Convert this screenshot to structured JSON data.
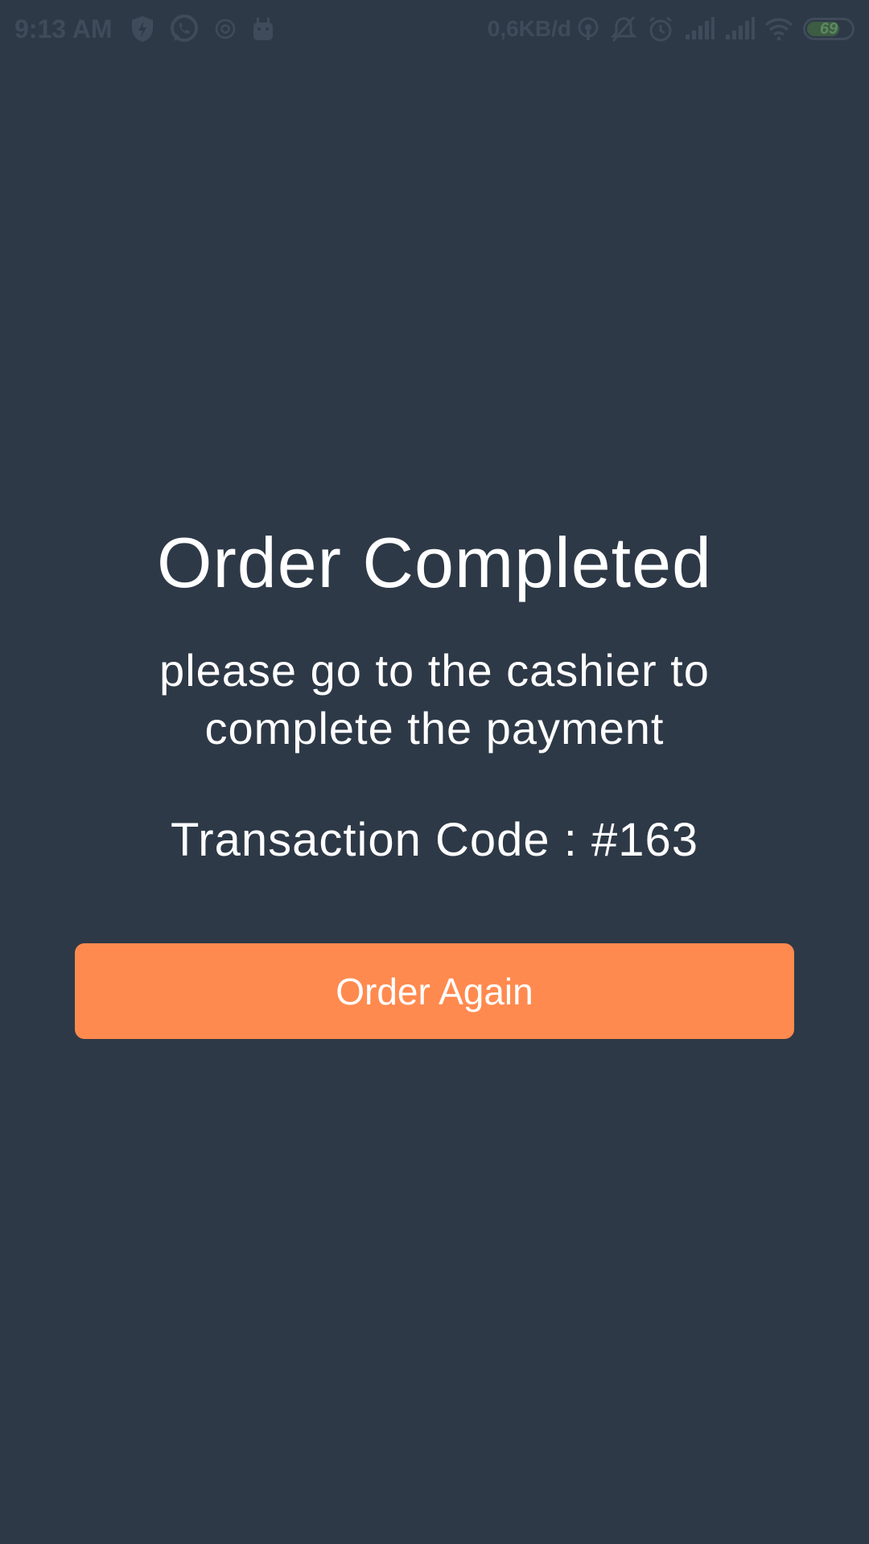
{
  "status_bar": {
    "time": "9:13 AM",
    "net_speed": "0,6KB/d",
    "battery_level": "69",
    "icons_left": [
      "shield-bolt-icon",
      "whatsapp-icon",
      "at-icon",
      "android-icon"
    ],
    "icons_right": [
      "hotspot-icon",
      "mute-icon",
      "alarm-icon",
      "signal-icon",
      "signal-icon",
      "wifi-icon",
      "battery-icon"
    ]
  },
  "main": {
    "title": "Order Completed",
    "message": "please go to the cashier to complete the payment",
    "transaction_label": "Transaction Code : #163",
    "order_again_label": "Order Again"
  },
  "colors": {
    "background": "#2e3947",
    "accent": "#ff8a4f",
    "text": "#ffffff",
    "status_bar_text": "#3f4b5a"
  }
}
